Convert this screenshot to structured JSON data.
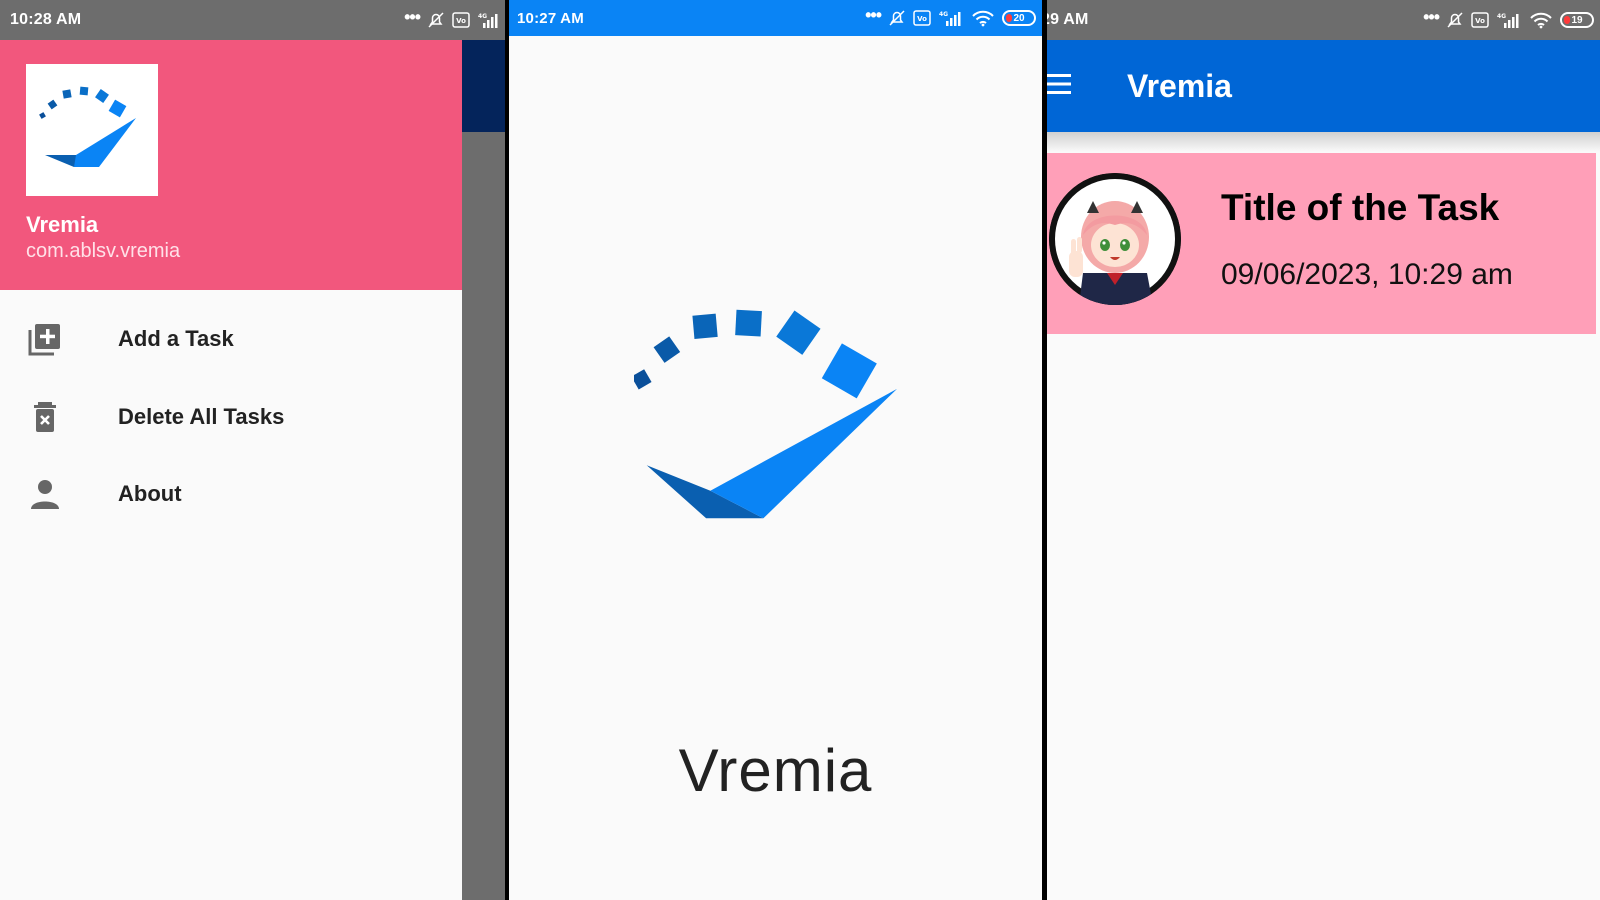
{
  "panel1": {
    "status": {
      "time": "10:28 AM"
    },
    "drawer": {
      "app_name": "Vremia",
      "package": "com.ablsv.vremia",
      "items": [
        {
          "label": "Add a Task",
          "icon": "add-task-icon"
        },
        {
          "label": "Delete All Tasks",
          "icon": "delete-icon"
        },
        {
          "label": "About",
          "icon": "person-icon"
        }
      ]
    }
  },
  "panel2": {
    "status": {
      "time": "10:27 AM",
      "battery": "20"
    },
    "splash": {
      "app_name": "Vremia"
    }
  },
  "panel3": {
    "status": {
      "time": "29 AM",
      "battery": "19"
    },
    "appbar": {
      "title": "Vremia"
    },
    "task": {
      "title": "Title of the Task",
      "date": "09/06/2023, 10:29 am"
    }
  },
  "colors": {
    "drawer_header": "#f2577d",
    "status_blue": "#0a84f5",
    "appbar_blue": "#0066d6",
    "task_card": "#ff9fb8",
    "logo_blue": "#0a84f5"
  }
}
